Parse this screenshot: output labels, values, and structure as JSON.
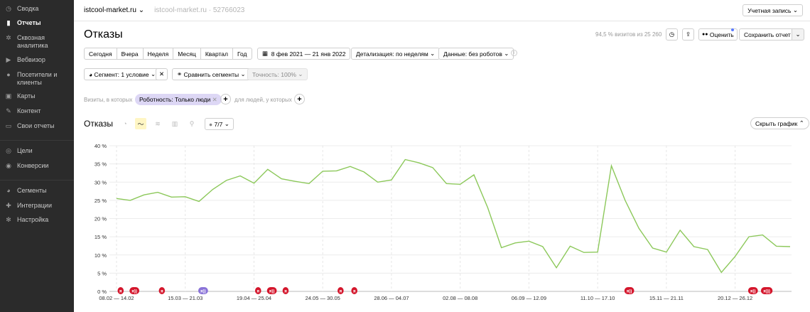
{
  "sidebar": {
    "items": [
      {
        "label": "Сводка",
        "icon": "dashboard-icon",
        "glyph": "◷",
        "active": false
      },
      {
        "label": "Отчеты",
        "icon": "reports-icon",
        "glyph": "▮",
        "active": true
      },
      {
        "label": "Сквозная аналитика",
        "icon": "analytics-icon",
        "glyph": "✲",
        "active": false
      },
      {
        "label": "Вебвизор",
        "icon": "play-icon",
        "glyph": "▶",
        "active": false
      },
      {
        "label": "Посетители и клиенты",
        "icon": "person-icon",
        "glyph": "●",
        "active": false
      },
      {
        "label": "Карты",
        "icon": "map-icon",
        "glyph": "▣",
        "active": false
      },
      {
        "label": "Контент",
        "icon": "pen-icon",
        "glyph": "✎",
        "active": false
      },
      {
        "label": "Свои отчеты",
        "icon": "screen-icon",
        "glyph": "▭",
        "active": false
      },
      {
        "label": "Цели",
        "icon": "target-icon",
        "glyph": "◎",
        "active": false
      },
      {
        "label": "Конверсии",
        "icon": "conversion-icon",
        "glyph": "◉",
        "active": false
      },
      {
        "label": "Сегменты",
        "icon": "pie-icon",
        "glyph": "◕",
        "active": false
      },
      {
        "label": "Интеграции",
        "icon": "puzzle-icon",
        "glyph": "✚",
        "active": false
      },
      {
        "label": "Настройка",
        "icon": "settings-icon",
        "glyph": "✻",
        "active": false
      }
    ]
  },
  "topbar": {
    "site": "istcool-market.ru",
    "site_sub": "istcool-market.ru · 52766023",
    "account": "Учетная запись"
  },
  "header": {
    "title": "Отказы",
    "visits_info": "94,5 % визитов из 25 260",
    "rate_label": "Оценить",
    "save_label": "Сохранить отчет"
  },
  "periods": [
    "Сегодня",
    "Вчера",
    "Неделя",
    "Месяц",
    "Квартал",
    "Год"
  ],
  "filters": {
    "date_range": "8 фев 2021 — 21 янв 2022",
    "detail": "Детализация: по неделям",
    "data": "Данные: без роботов"
  },
  "segment": {
    "label": "Сегмент: 1 условие",
    "compare": "Сравнить сегменты",
    "accuracy": "Точность: 100%"
  },
  "conditions": {
    "prefix": "Визиты, в которых",
    "chip": "Роботность: Только люди",
    "mid": "для людей, у которых"
  },
  "chart_panel": {
    "title": "Отказы",
    "series_count": "7/7",
    "hide": "Скрыть график"
  },
  "colors": {
    "line": "#8cc85a",
    "annotation_red": "#d4162c",
    "annotation_purple": "#8a73d8",
    "chip_bg": "#ddd7f5"
  },
  "chart_data": {
    "type": "line",
    "xlabel": "",
    "ylabel": "",
    "ylim": [
      0,
      40
    ],
    "y_ticks": [
      "0 %",
      "5 %",
      "10 %",
      "15 %",
      "20 %",
      "25 %",
      "30 %",
      "35 %",
      "40 %"
    ],
    "x_tick_labels": [
      "08.02 — 14.02",
      "15.03 — 21.03",
      "19.04 — 25.04",
      "24.05 — 30.05",
      "28.06 — 04.07",
      "02.08 — 08.08",
      "06.09 — 12.09",
      "11.10 — 17.10",
      "15.11 — 21.11",
      "20.12 — 26.12"
    ],
    "x_tick_index": [
      0,
      5,
      10,
      15,
      20,
      25,
      30,
      35,
      40,
      45
    ],
    "series": [
      {
        "values": [
          25.5,
          25,
          26.5,
          27.2,
          25.9,
          26,
          24.7,
          28,
          30.5,
          31.7,
          29.7,
          33.5,
          30.9,
          30.2,
          29.6,
          33,
          33.1,
          34.3,
          32.8,
          30,
          30.6,
          36.2,
          35.3,
          34,
          29.6,
          29.4,
          32,
          23,
          12,
          13.3,
          13.8,
          12.3,
          6.5,
          12.4,
          10.7,
          10.8,
          34.5,
          25,
          17.3,
          11.9,
          10.8,
          16.8,
          12.3,
          11.5,
          5.2,
          9.6,
          15,
          15.5,
          12.4,
          12.3
        ]
      }
    ],
    "annotations": [
      {
        "index": 0.3,
        "label": "я",
        "color": "red"
      },
      {
        "index": 1.3,
        "label": "я))",
        "color": "red"
      },
      {
        "index": 3.3,
        "label": "я",
        "color": "red"
      },
      {
        "index": 6.3,
        "label": "я))",
        "color": "purple"
      },
      {
        "index": 10.3,
        "label": "я",
        "color": "red"
      },
      {
        "index": 11.3,
        "label": "я))",
        "color": "red"
      },
      {
        "index": 12.3,
        "label": "я",
        "color": "red"
      },
      {
        "index": 16.3,
        "label": "я",
        "color": "red"
      },
      {
        "index": 17.3,
        "label": "я",
        "color": "red"
      },
      {
        "index": 37.3,
        "label": "я))",
        "color": "red"
      },
      {
        "index": 46.3,
        "label": "я))",
        "color": "red"
      },
      {
        "index": 47.3,
        "label": "я)))",
        "color": "red"
      }
    ]
  }
}
